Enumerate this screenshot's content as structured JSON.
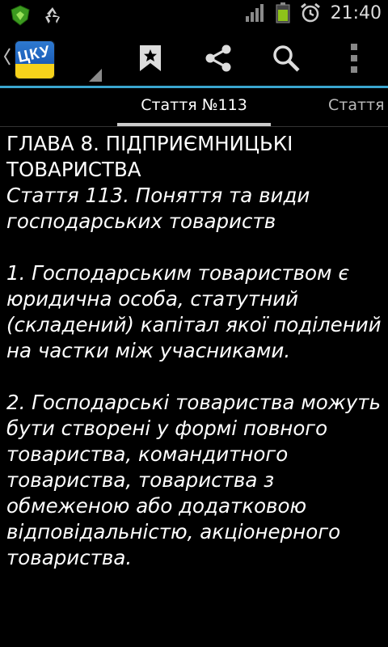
{
  "status_bar": {
    "time": "21:40",
    "icons": [
      "security-shield-icon",
      "recycle-icon",
      "signal-icon",
      "battery-icon",
      "alarm-icon"
    ]
  },
  "action_bar": {
    "app_icon_text": "ЦКУ",
    "actions": [
      "bookmark-icon",
      "share-icon",
      "search-icon",
      "overflow-menu-icon"
    ],
    "accent_color": "#3aa6cf"
  },
  "tabs": {
    "active": "Стаття №113",
    "next": "Стаття"
  },
  "content": {
    "chapter": "ГЛАВА 8.  ПІДПРИЄМНИЦЬКІ ТОВАРИСТВА",
    "article_title": "Стаття 113. Поняття та види господарських товариств",
    "paragraphs": [
      "1. Господарським товариством є юридична особа, статутний (складений) капітал якої поділений на частки між учасниками.",
      "2. Господарські товариства можуть бути створені у формі повного товариства, командитного товариства, товариства з обмеженою або додатковою відповідальністю, акціонерного товариства."
    ]
  }
}
